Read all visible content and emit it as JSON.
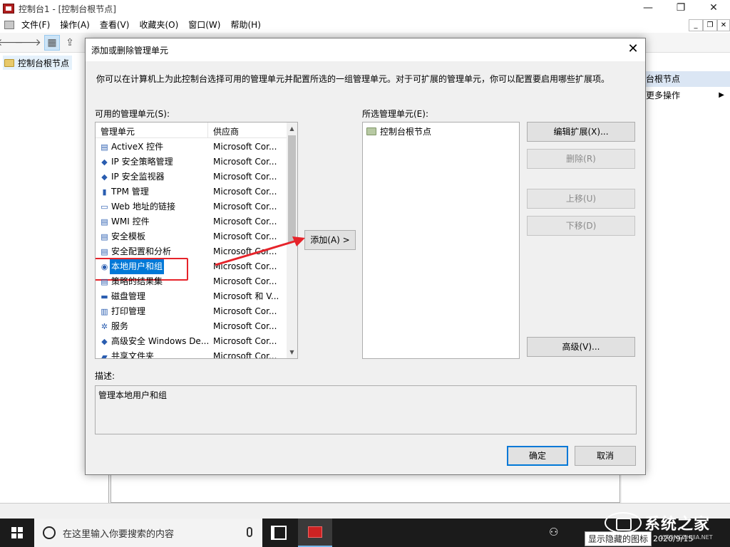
{
  "window": {
    "title": "控制台1 - [控制台根节点]",
    "minimize_icon": "minimize-icon",
    "restore_icon": "restore-icon",
    "close_icon": "close-icon",
    "controls": {
      "min": "—",
      "restore": "❐",
      "close": "✕"
    }
  },
  "menubar": {
    "items": [
      "文件(F)",
      "操作(A)",
      "查看(V)",
      "收藏夹(O)",
      "窗口(W)",
      "帮助(H)"
    ],
    "mdi": {
      "min": "_",
      "restore": "❐",
      "close": "✕"
    }
  },
  "toolbar": {
    "back": "🡐",
    "forward": "🡒",
    "console_tree": "▦",
    "export": "⇪",
    "help": "?",
    "view": "▣"
  },
  "tree": {
    "root": "控制台根节点"
  },
  "actions_pane": {
    "header": "台根节点",
    "more": "更多操作",
    "more_arrow": "▶"
  },
  "taskbar": {
    "search_placeholder": "在这里输入你要搜索的内容",
    "tray_people": "⚇",
    "tray_clip": "显示隐藏的图标",
    "date": "2020/9/15"
  },
  "watermark": {
    "text": "系统之家",
    "url": "XITONGZHIJIA.NET"
  },
  "dialog": {
    "title": "添加或删除管理单元",
    "close": "✕",
    "description": "你可以在计算机上为此控制台选择可用的管理单元并配置所选的一组管理单元。对于可扩展的管理单元，你可以配置要启用哪些扩展项。",
    "available_label": "可用的管理单元(S):",
    "selected_label": "所选管理单元(E):",
    "col_snapin": "管理单元",
    "col_vendor": "供应商",
    "scroll_up": "▲",
    "scroll_down": "▼",
    "snapins": [
      {
        "name": "ActiveX 控件",
        "vendor": "Microsoft Cor...",
        "icon": "activex-icon",
        "glyph": "▤"
      },
      {
        "name": "IP 安全策略管理",
        "vendor": "Microsoft Cor...",
        "icon": "ip-security-policy-icon",
        "glyph": "◆"
      },
      {
        "name": "IP 安全监视器",
        "vendor": "Microsoft Cor...",
        "icon": "ip-security-monitor-icon",
        "glyph": "◆"
      },
      {
        "name": "TPM 管理",
        "vendor": "Microsoft Cor...",
        "icon": "tpm-icon",
        "glyph": "▮"
      },
      {
        "name": "Web 地址的链接",
        "vendor": "Microsoft Cor...",
        "icon": "web-link-icon",
        "glyph": "▭"
      },
      {
        "name": "WMI 控件",
        "vendor": "Microsoft Cor...",
        "icon": "wmi-icon",
        "glyph": "▤"
      },
      {
        "name": "安全模板",
        "vendor": "Microsoft Cor...",
        "icon": "security-template-icon",
        "glyph": "▤"
      },
      {
        "name": "安全配置和分析",
        "vendor": "Microsoft Cor...",
        "icon": "security-config-icon",
        "glyph": "▤"
      },
      {
        "name": "本地用户和组",
        "vendor": "Microsoft Cor...",
        "icon": "local-users-icon",
        "glyph": "◉"
      },
      {
        "name": "策略的结果集",
        "vendor": "Microsoft Cor...",
        "icon": "policy-results-icon",
        "glyph": "▤"
      },
      {
        "name": "磁盘管理",
        "vendor": "Microsoft 和 V...",
        "icon": "disk-icon",
        "glyph": "▬"
      },
      {
        "name": "打印管理",
        "vendor": "Microsoft Cor...",
        "icon": "print-icon",
        "glyph": "▥"
      },
      {
        "name": "服务",
        "vendor": "Microsoft Cor...",
        "icon": "services-icon",
        "glyph": "✲"
      },
      {
        "name": "高级安全 Windows De...",
        "vendor": "Microsoft Cor...",
        "icon": "firewall-icon",
        "glyph": "◆"
      },
      {
        "name": "共享文件夹",
        "vendor": "Microsoft Cor...",
        "icon": "shared-folder-icon",
        "glyph": "▰"
      }
    ],
    "selected_index": 8,
    "add_button": "添加(A) >",
    "selected_items": [
      "控制台根节点"
    ],
    "edit_ext_button": "编辑扩展(X)...",
    "remove_button": "删除(R)",
    "move_up_button": "上移(U)",
    "move_down_button": "下移(D)",
    "advanced_button": "高级(V)...",
    "desc_label": "描述:",
    "desc_value": "管理本地用户和组",
    "ok_button": "确定",
    "cancel_button": "取消"
  }
}
